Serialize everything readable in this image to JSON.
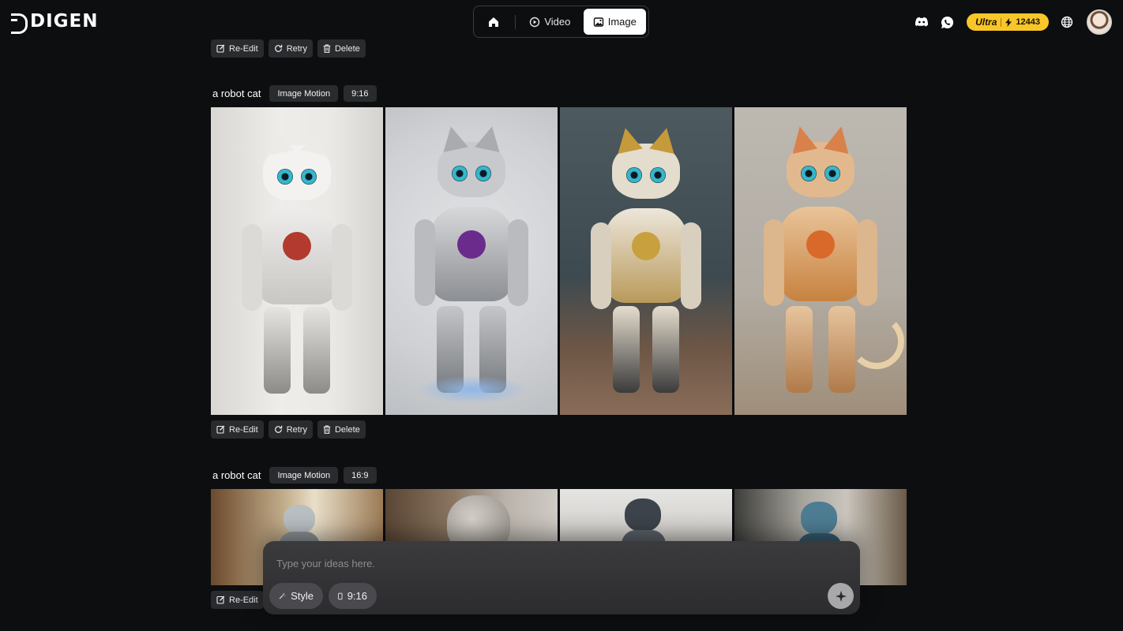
{
  "brand": {
    "name": "DIGEN"
  },
  "modes": [
    {
      "label": "Video",
      "icon": "video-icon"
    },
    {
      "label": "Image",
      "icon": "image-icon",
      "active": true
    }
  ],
  "account": {
    "plan": "Ultra",
    "credits": "12443",
    "icons": [
      "discord-icon",
      "whatsapp-icon",
      "globe-icon"
    ]
  },
  "actions": {
    "reedit": "Re-Edit",
    "retry": "Retry",
    "delete": "Delete"
  },
  "generations": [
    {
      "prompt": "a robot cat",
      "tags": [
        "Image Motion",
        "9:16"
      ],
      "images": 4
    },
    {
      "prompt": "a robot cat",
      "tags": [
        "Image Motion",
        "16:9"
      ],
      "images": 4
    }
  ],
  "composer": {
    "placeholder": "Type your ideas here.",
    "style_label": "Style",
    "ratio_label": "9:16"
  },
  "colors": {
    "background": "#0d0e10",
    "chip": "#2a2b2e",
    "accent": "#f8c628",
    "composer": "#343437"
  }
}
